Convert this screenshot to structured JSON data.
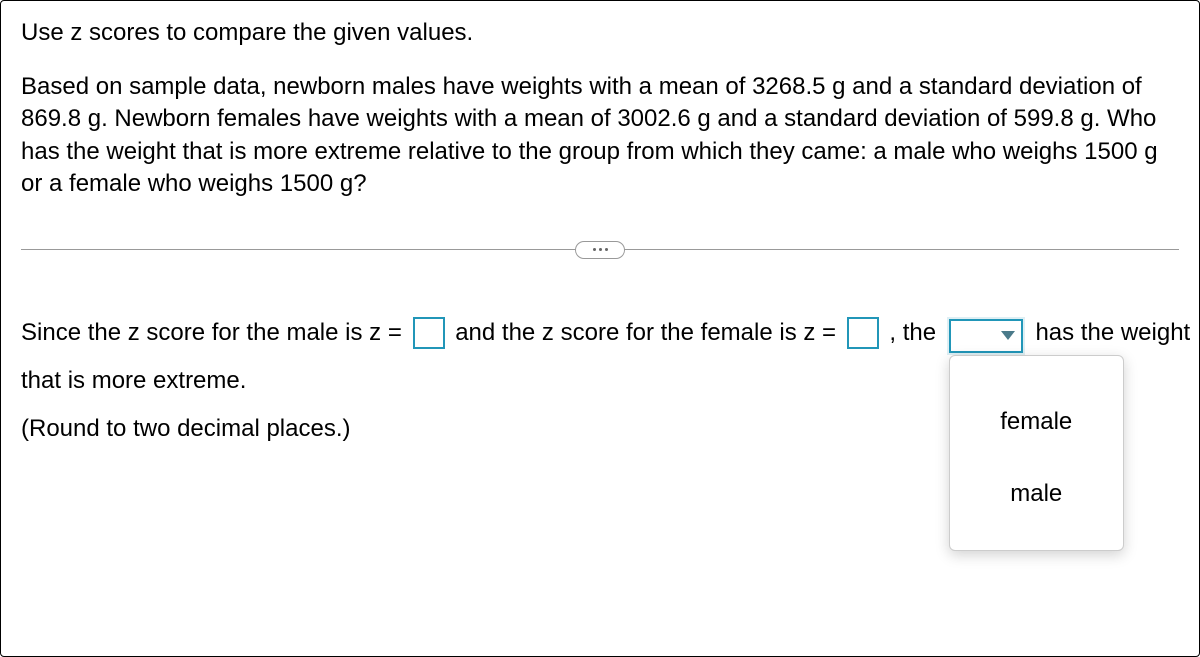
{
  "instruction": "Use z scores to compare the given values.",
  "problem": "Based on sample data, newborn males have weights with a mean of 3268.5 g and a standard deviation of 869.8 g. Newborn females have weights with a mean of 3002.6 g and a standard deviation of 599.8 g. Who has the weight that is more extreme relative to the group from which they came: a male who weighs 1500 g or a female who weighs 1500 g?",
  "answer": {
    "part1": "Since the z score for the male is z =",
    "part2": "and the z score for the female is z =",
    "part3": ", the",
    "part4": "has the weight",
    "part5": "that is more extreme.",
    "hint": "(Round to two decimal places.)",
    "male_z_value": "",
    "female_z_value": "",
    "select_value": ""
  },
  "dropdown": {
    "options": [
      "female",
      "male"
    ]
  }
}
